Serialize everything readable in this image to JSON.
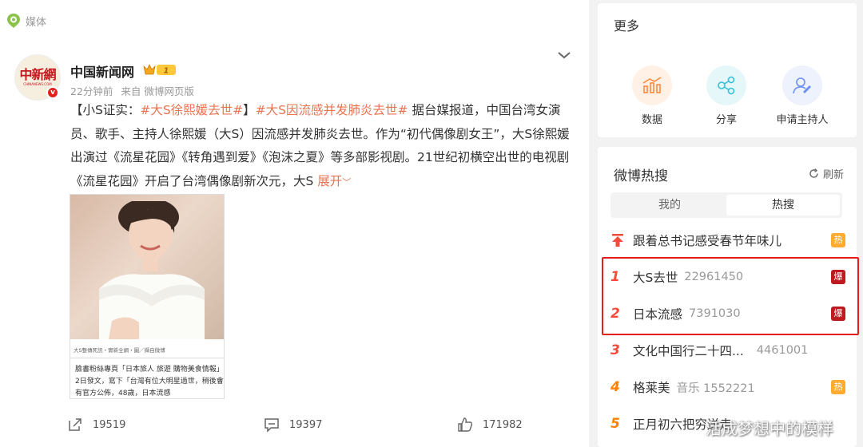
{
  "media_tag": "媒体",
  "author": {
    "name": "中国新闻网",
    "avatar_text": "中新網",
    "avatar_subtext": "CHINANEWS.COM",
    "vip_level": "1",
    "time": "22分钟前",
    "source": "来自 微博网页版"
  },
  "post": {
    "prefix": "【小S证实：",
    "tag1": "#大S徐熙媛去世#",
    "mid": "】",
    "tag2": "#大S因流感并发肺炎去世#",
    "body": " 据台媒报道，中国台湾女演员、歌手、主持人徐熙媛（大S）因流感并发肺炎去世。作为“初代偶像剧女王”，大S徐熙媛出演过《流星花园》《转角遇到爱》《泡沫之夏》等多部影视剧。21世纪初横空出世的电视剧《流星花园》开启了台湾偶像剧新次元，大S ",
    "expand": "展开",
    "image_source_caption": "大S整傳死訊・實新全網・圖／擷自微博",
    "image_caption": "臉書粉絲專頁「日本旅人 旅遊 購物美食情報」2日發文，寫下「台灣有位大明星過世，稍後會有官方公佈，48歲，日本流感"
  },
  "actions": {
    "repost": "19519",
    "comment": "19397",
    "like": "171982"
  },
  "more": {
    "title": "更多",
    "items": [
      {
        "label": "数据",
        "icon": "chart-icon",
        "color": "#ff8a3d"
      },
      {
        "label": "分享",
        "icon": "share-icon",
        "color": "#35c0d8"
      },
      {
        "label": "申请主持人",
        "icon": "user-edit-icon",
        "color": "#6b8ff0"
      }
    ]
  },
  "hot": {
    "title": "微博热搜",
    "refresh": "刷新",
    "tabs": [
      "我的",
      "热搜"
    ],
    "pinned": {
      "title": "跟着总书记感受春节年味儿",
      "tag": "热"
    },
    "items": [
      {
        "rank": "1",
        "title": "大S去世",
        "count": "22961450",
        "tag": "爆"
      },
      {
        "rank": "2",
        "title": "日本流感",
        "count": "7391030",
        "tag": "爆"
      },
      {
        "rank": "3",
        "title": "文化中国行二十四...",
        "count": "4461001",
        "tag": ""
      },
      {
        "rank": "4",
        "title": "格莱美",
        "count": "音乐 1552221",
        "tag": "热"
      },
      {
        "rank": "5",
        "title": "正月初六把穷送走",
        "count": "",
        "tag": ""
      }
    ]
  },
  "watermark": "活成梦想中的模样"
}
